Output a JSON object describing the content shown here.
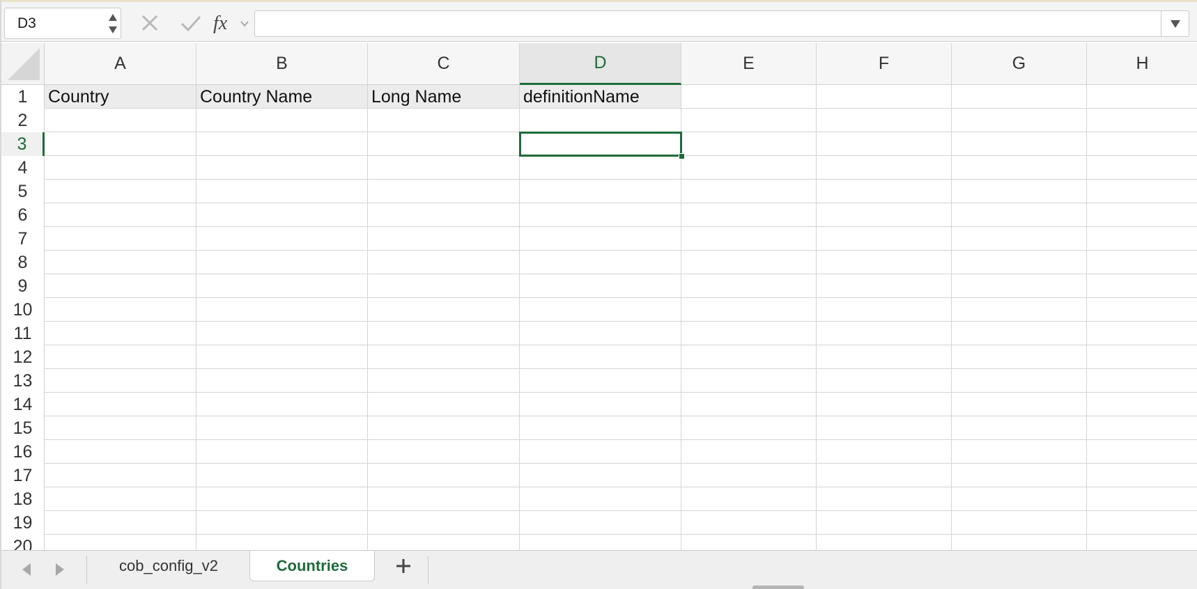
{
  "formula_bar": {
    "name_box": "D3",
    "formula": ""
  },
  "columns": [
    "A",
    "B",
    "C",
    "D",
    "E",
    "F",
    "G",
    "H"
  ],
  "active_column": "D",
  "rows": [
    "1",
    "2",
    "3",
    "4",
    "5",
    "6",
    "7",
    "8",
    "9",
    "10",
    "11",
    "12",
    "13",
    "14",
    "15",
    "16",
    "17",
    "18",
    "19",
    "20"
  ],
  "active_row": "3",
  "cells": {
    "A1": "Country",
    "B1": "Country Name",
    "C1": "Long Name",
    "D1": "definitionName"
  },
  "sheet_tabs": [
    {
      "label": "cob_config_v2",
      "active": false
    },
    {
      "label": "Countries",
      "active": true
    }
  ],
  "colors": {
    "accent": "#1e6b3a",
    "header_fill": "#ececec"
  },
  "icons": {
    "cancel": "x-icon",
    "enter": "check-icon",
    "function": "fx-icon",
    "add_sheet": "plus-icon"
  }
}
